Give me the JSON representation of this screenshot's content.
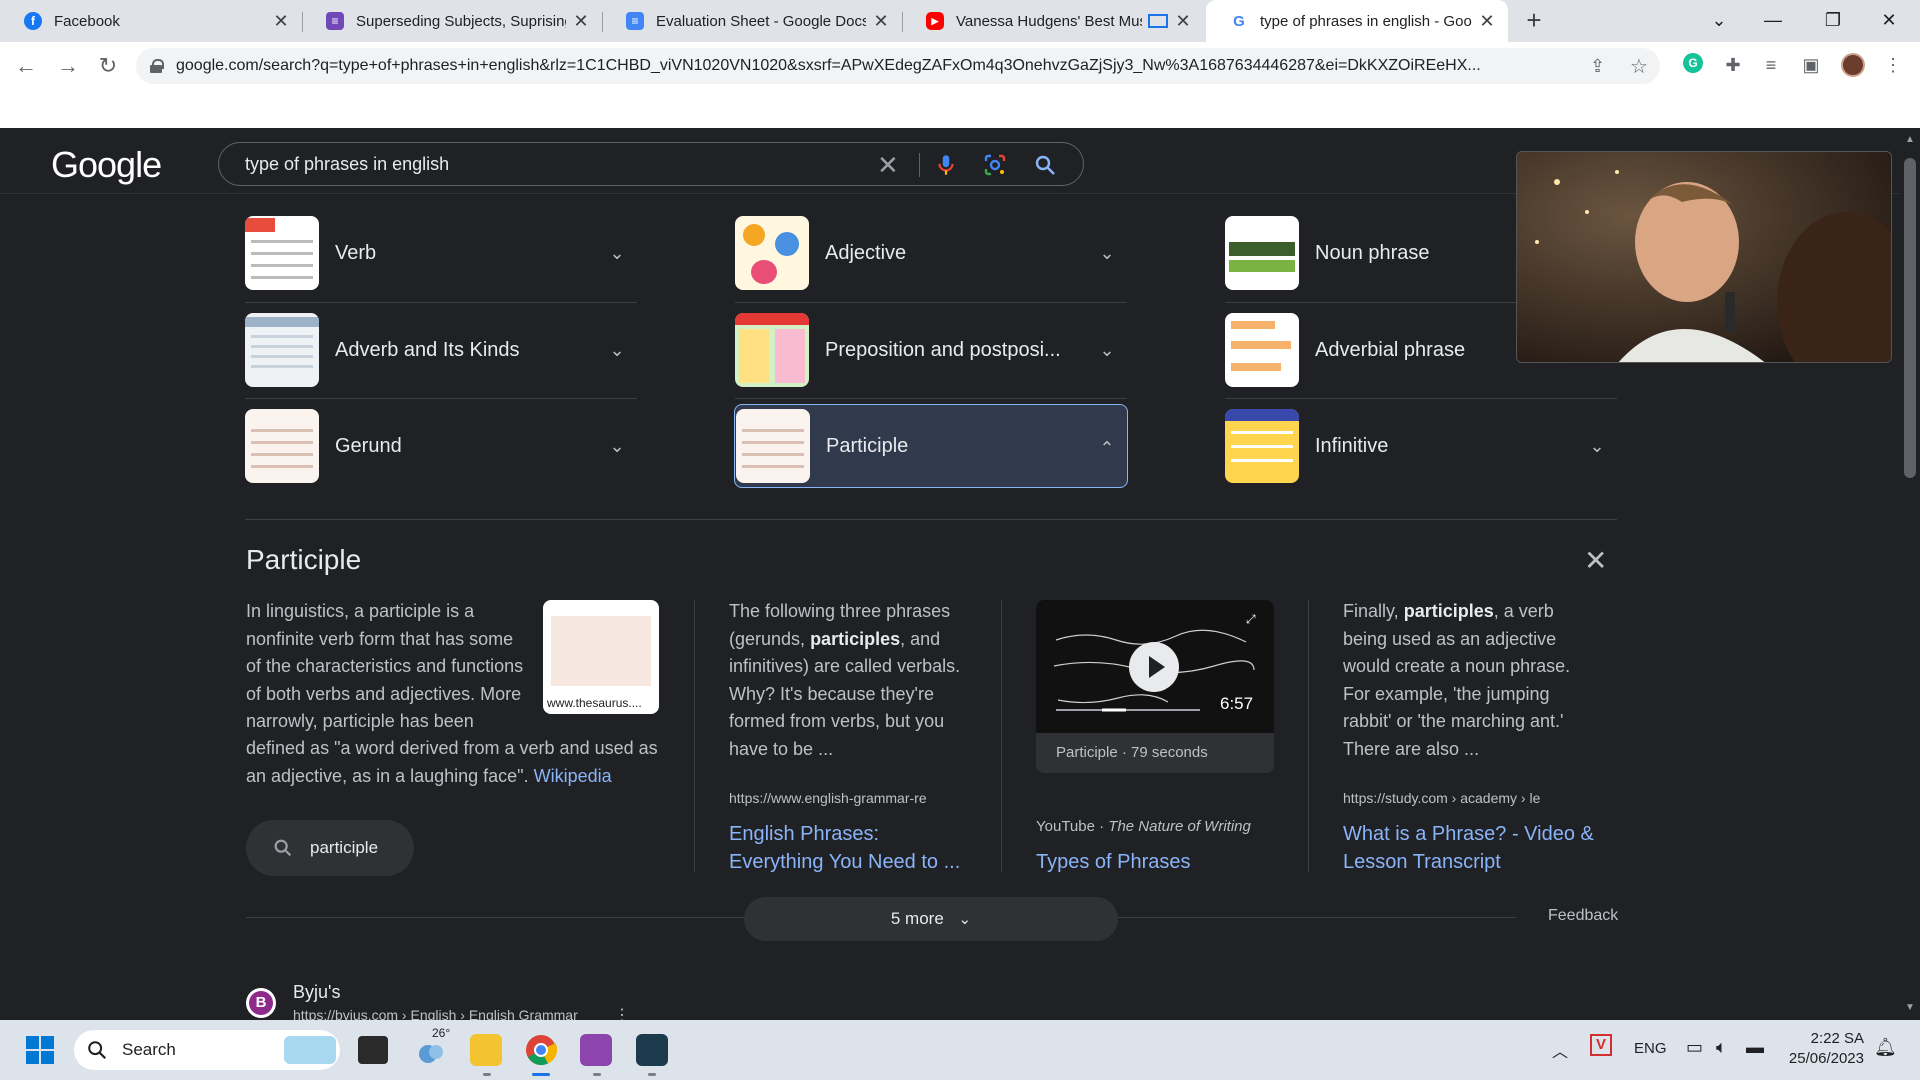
{
  "browser": {
    "tabs": [
      {
        "title": "Facebook",
        "favicon": "facebook-icon",
        "color": "#1877f2"
      },
      {
        "title": "Superseding Subjects, Suprising S",
        "favicon": "forms-icon",
        "color": "#7248b9"
      },
      {
        "title": "Evaluation Sheet - Google Docs",
        "favicon": "docs-icon",
        "color": "#4285f4"
      },
      {
        "title": "Vanessa Hudgens' Best Musi",
        "favicon": "youtube-icon",
        "color": "#ff0000"
      },
      {
        "title": "type of phrases in english - Goog",
        "favicon": "google-icon",
        "color": "#4285f4"
      }
    ],
    "new_tab": "+",
    "url": "google.com/search?q=type+of+phrases+in+english&rlz=1C1CHBD_viVN1020VN1020&sxsrf=APwXEdegZAFxOm4q3OnehvzGaZjSjy3_Nw%3A1687634446287&ei=DkKXZOiREeHX..."
  },
  "google": {
    "logo": "Google",
    "query": "type of phrases in english"
  },
  "topics": [
    {
      "label": "Verb",
      "expanded": false
    },
    {
      "label": "Adjective",
      "expanded": false
    },
    {
      "label": "Noun phrase",
      "expanded": false
    },
    {
      "label": "Adverb and Its Kinds",
      "expanded": false
    },
    {
      "label": "Preposition and postposi...",
      "expanded": false
    },
    {
      "label": "Adverbial phrase",
      "expanded": false
    },
    {
      "label": "Gerund",
      "expanded": false
    },
    {
      "label": "Participle",
      "expanded": true
    },
    {
      "label": "Infinitive",
      "expanded": false
    }
  ],
  "panel": {
    "title": "Participle",
    "wiki_text_1": "In linguistics, a participle is a nonfinite verb form that has some of the characteristics and functions of both verbs and adjectives. More narrowly, participle has been",
    "wiki_text_2": "defined as \"a word derived from a verb and used as an adjective, as in a laughing face\".",
    "wiki_link": "Wikipedia",
    "wiki_image_source": "www.thesaurus....",
    "chip": "participle",
    "result_2": {
      "snippet_a": "The following three phrases (gerunds,",
      "snippet_bold": "participles",
      "snippet_b": ", and infinitives) are called verbals. Why? It's because they're formed from verbs, but you have to be ...",
      "cite": "https://www.english-grammar-re",
      "title": "English Phrases: Everything You Need to ..."
    },
    "video": {
      "duration": "6:57",
      "caption": "Participle · 79 seconds",
      "source": "YouTube",
      "channel": "The Nature of Writing",
      "title": "Types of Phrases"
    },
    "result_4": {
      "snippet_a": "Finally,",
      "snippet_bold": "participles",
      "snippet_b": ", a verb being used as an adjective would create a noun phrase. For example, 'the jumping rabbit' or 'the marching ant.' There are also ...",
      "cite": "https://study.com › academy › le",
      "title": "What is a Phrase? - Video & Lesson Transcript"
    },
    "more_button": "5 more",
    "feedback": "Feedback"
  },
  "next_result": {
    "site": "Byju's",
    "url": "https://byjus.com › English › English Grammar"
  },
  "taskbar": {
    "search_placeholder": "Search",
    "weather": "26°",
    "language": "ENG",
    "time": "2:22 SA",
    "date": "25/06/2023"
  }
}
